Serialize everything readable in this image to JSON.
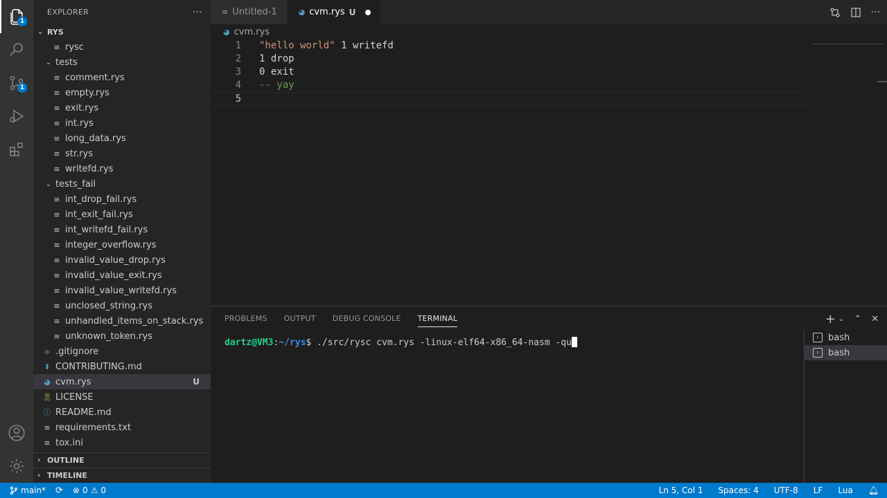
{
  "activity_bar": {
    "explorer_badge": "1",
    "source_control_badge": "1"
  },
  "sidebar": {
    "title": "EXPLORER",
    "more": "···",
    "root_label": "RYS",
    "items": [
      {
        "label": "rysc",
        "kind": "file-plain",
        "depth": 1
      },
      {
        "label": "tests",
        "kind": "folder-open",
        "depth": 0
      },
      {
        "label": "comment.rys",
        "kind": "file-plain",
        "depth": 1
      },
      {
        "label": "empty.rys",
        "kind": "file-plain",
        "depth": 1
      },
      {
        "label": "exit.rys",
        "kind": "file-plain",
        "depth": 1
      },
      {
        "label": "int.rys",
        "kind": "file-plain",
        "depth": 1
      },
      {
        "label": "long_data.rys",
        "kind": "file-plain",
        "depth": 1
      },
      {
        "label": "str.rys",
        "kind": "file-plain",
        "depth": 1
      },
      {
        "label": "writefd.rys",
        "kind": "file-plain",
        "depth": 1
      },
      {
        "label": "tests_fail",
        "kind": "folder-open",
        "depth": 0
      },
      {
        "label": "int_drop_fail.rys",
        "kind": "file-plain",
        "depth": 1
      },
      {
        "label": "int_exit_fail.rys",
        "kind": "file-plain",
        "depth": 1
      },
      {
        "label": "int_writefd_fail.rys",
        "kind": "file-plain",
        "depth": 1
      },
      {
        "label": "integer_overflow.rys",
        "kind": "file-plain",
        "depth": 1
      },
      {
        "label": "invalid_value_drop.rys",
        "kind": "file-plain",
        "depth": 1
      },
      {
        "label": "invalid_value_exit.rys",
        "kind": "file-plain",
        "depth": 1
      },
      {
        "label": "invalid_value_writefd.rys",
        "kind": "file-plain",
        "depth": 1
      },
      {
        "label": "unclosed_string.rys",
        "kind": "file-plain",
        "depth": 1
      },
      {
        "label": "unhandled_items_on_stack.rys",
        "kind": "file-plain",
        "depth": 1
      },
      {
        "label": "unknown_token.rys",
        "kind": "file-plain",
        "depth": 1
      },
      {
        "label": ".gitignore",
        "kind": "file-git",
        "depth": 0
      },
      {
        "label": "CONTRIBUTING.md",
        "kind": "file-md",
        "depth": 0
      },
      {
        "label": "cvm.rys",
        "kind": "file-lua",
        "depth": 0,
        "badge": "U",
        "selected": true
      },
      {
        "label": "LICENSE",
        "kind": "file-license",
        "depth": 0
      },
      {
        "label": "README.md",
        "kind": "file-info",
        "depth": 0
      },
      {
        "label": "requirements.txt",
        "kind": "file-plain",
        "depth": 0
      },
      {
        "label": "tox.ini",
        "kind": "file-plain",
        "depth": 0
      }
    ],
    "outline_label": "OUTLINE",
    "timeline_label": "TIMELINE"
  },
  "tabs": [
    {
      "label": "Untitled-1",
      "active": false
    },
    {
      "label": "cvm.rys",
      "active": true,
      "modifier": "U"
    }
  ],
  "breadcrumb": {
    "file": "cvm.rys"
  },
  "editor": {
    "lines": [
      {
        "num": "1",
        "tokens": [
          {
            "t": "\"hello world\"",
            "c": "str"
          },
          {
            "t": " 1 writefd",
            "c": "plain"
          }
        ]
      },
      {
        "num": "2",
        "tokens": [
          {
            "t": "1 drop",
            "c": "plain"
          }
        ]
      },
      {
        "num": "3",
        "tokens": [
          {
            "t": "0 exit",
            "c": "plain"
          }
        ]
      },
      {
        "num": "4",
        "tokens": [
          {
            "t": "-- yay",
            "c": "comment"
          }
        ]
      },
      {
        "num": "5",
        "tokens": []
      }
    ],
    "current_line": "5"
  },
  "panel": {
    "tabs": [
      "PROBLEMS",
      "OUTPUT",
      "DEBUG CONSOLE",
      "TERMINAL"
    ],
    "active_tab": "TERMINAL",
    "terminal": {
      "user": "dartz@VM3",
      "sep": ":",
      "path": "~/rys",
      "prompt": "$ ",
      "command": "./src/rysc cvm.rys -linux-elf64-x86_64-nasm -qu"
    },
    "terminals": [
      "bash",
      "bash"
    ]
  },
  "statusbar": {
    "branch": "main*",
    "errors": "0",
    "warnings": "0",
    "position": "Ln 5, Col 1",
    "spaces": "Spaces: 4",
    "encoding": "UTF-8",
    "eol": "LF",
    "language": "Lua"
  },
  "colors": {
    "accent": "#007acc",
    "activity_bar": "#333333",
    "sidebar": "#252526",
    "editor_bg": "#1e1e1e"
  }
}
